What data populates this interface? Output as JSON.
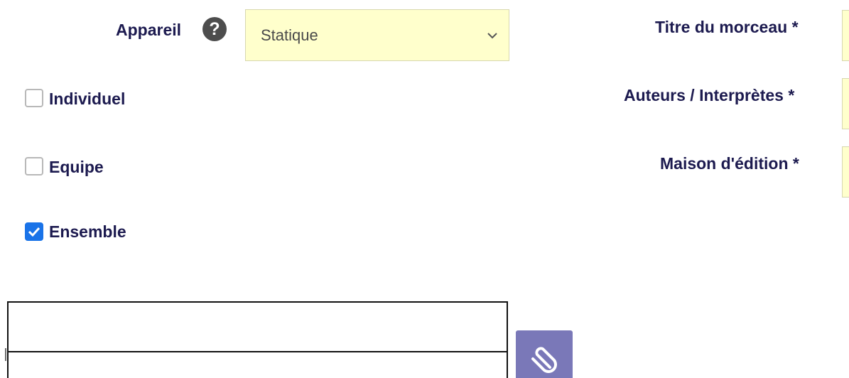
{
  "left_form": {
    "device_label": "Appareil",
    "help_icon": "question-circle-icon",
    "device_select_value": "Statique",
    "checkboxes": [
      {
        "label": "Individuel",
        "checked": false
      },
      {
        "label": "Equipe",
        "checked": false
      },
      {
        "label": "Ensemble",
        "checked": true
      }
    ]
  },
  "right_form": {
    "title_label": "Titre du morceau *",
    "authors_label": "Auteurs / Interprètes *",
    "publisher_label": "Maison d'édition *"
  },
  "attachment": {
    "icon": "paperclip-icon"
  },
  "colors": {
    "label_text": "#1c1a4f",
    "field_background": "#ffffcc",
    "checkbox_checked": "#1a73e8",
    "attach_button": "#7a78b8"
  }
}
